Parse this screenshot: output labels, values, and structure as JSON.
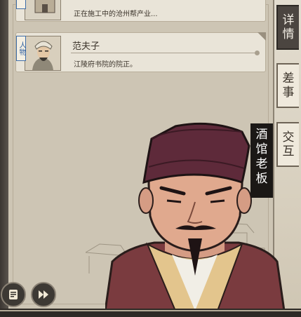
{
  "cards": [
    {
      "tag": "",
      "name": "",
      "desc": "正在施工中的沧州帮产业..."
    },
    {
      "tag": "人物",
      "name": "范夫子",
      "desc": "江陵府书院的院正。"
    }
  ],
  "tabs": [
    {
      "label": "详情",
      "chars": [
        "详",
        "情"
      ],
      "active": true
    },
    {
      "label": "差事",
      "chars": [
        "差",
        "事"
      ],
      "active": false
    },
    {
      "label": "交互",
      "chars": [
        "交",
        "互"
      ],
      "active": false
    }
  ],
  "speaker": {
    "label": "酒馆老板",
    "chars": [
      "酒",
      "馆",
      "老",
      "板"
    ]
  },
  "controls": {
    "log_icon": "log-icon",
    "fast_forward_icon": "fast-forward-icon"
  },
  "colors": {
    "active_tab": "#4b4540",
    "banner": "#1b1816",
    "hat": "#5e2a3a",
    "robe": "#7a3b3f"
  }
}
